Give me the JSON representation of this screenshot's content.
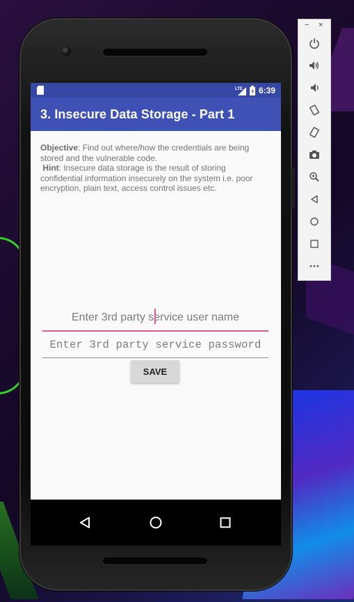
{
  "status_bar": {
    "time": "6:39",
    "network": "LTE",
    "icons": [
      "sd-card-icon",
      "signal-icon",
      "battery-icon"
    ]
  },
  "app_bar": {
    "title": "3. Insecure Data Storage - Part 1"
  },
  "description": {
    "objective_label": "Objective",
    "objective_text": ": Find out where/how the credentials are being stored and the vulnerable code.",
    "hint_label": "Hint",
    "hint_text": ": Insecure data storage is the result of storing confidential information insecurely on the system i.e. poor encryption, plain text, access control issues etc."
  },
  "form": {
    "username_placeholder": "Enter 3rd party service user name",
    "password_placeholder": "Enter 3rd party service password",
    "save_label": "SAVE"
  },
  "nav_bar": {
    "buttons": [
      "back-icon",
      "home-icon",
      "recents-icon"
    ]
  },
  "emulator_toolbar": {
    "window_controls": [
      "−",
      "×"
    ],
    "tools": [
      "power-icon",
      "volume-up-icon",
      "volume-down-icon",
      "rotate-left-icon",
      "rotate-right-icon",
      "camera-icon",
      "zoom-icon",
      "back-icon",
      "home-icon",
      "overview-icon",
      "more-icon"
    ]
  },
  "colors": {
    "status_bar": "#3747a6",
    "app_bar": "#3f51b5",
    "accent": "#e0568f",
    "button": "#d8d8d8"
  }
}
